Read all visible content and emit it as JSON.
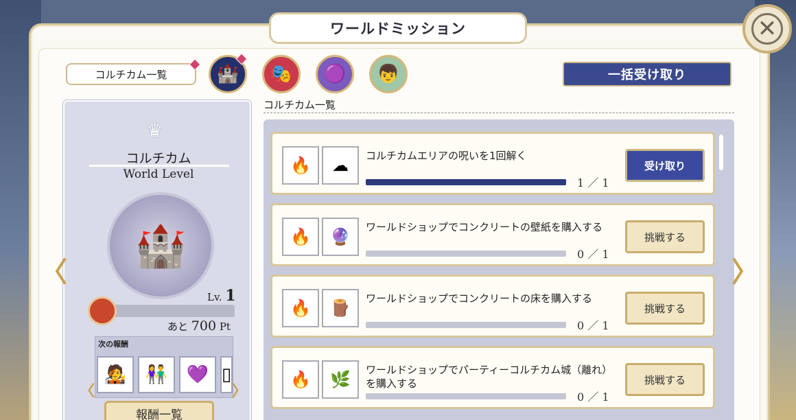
{
  "window": {
    "title": "ワールドミッション",
    "close_icon": "close-icon"
  },
  "header": {
    "category_select": "コルチカム一覧",
    "bulk_claim_label": "一括受け取り",
    "character_avatars": [
      {
        "name": "castle-emblem-avatar",
        "glyph": "🏰",
        "bg": "#23306a",
        "selected": true,
        "badge": true
      },
      {
        "name": "character-avatar-1",
        "glyph": "🎭",
        "bg": "#c93a4a",
        "selected": false,
        "badge": false
      },
      {
        "name": "character-avatar-2",
        "glyph": "🟣",
        "bg": "#7b5bbd",
        "selected": false,
        "badge": false
      },
      {
        "name": "character-avatar-3",
        "glyph": "👦",
        "bg": "#9fc7a8",
        "selected": false,
        "badge": false
      }
    ]
  },
  "list_label": "コルチカム一覧",
  "world": {
    "name": "コルチカム",
    "subtitle": "World Level",
    "level_prefix": "Lv.",
    "level": "1",
    "remaining_prefix": "あと",
    "remaining_value": "700",
    "remaining_unit": "Pt",
    "progress": 0.0,
    "rewards_title": "次の報酬",
    "reward_thumbs": [
      "🧑‍🎤",
      "👫",
      "💜",
      "▯"
    ],
    "listing_label": "報酬一覧"
  },
  "missions": [
    {
      "title": "コルチカムエリアの呪いを1回解く",
      "current": 1,
      "total": 1,
      "count_text": "1 ／ 1",
      "button": "受け取り",
      "state": "claim",
      "icons": [
        "🔥",
        "☁"
      ]
    },
    {
      "title": "ワールドショップでコンクリートの壁紙を購入する",
      "current": 0,
      "total": 1,
      "count_text": "0 ／ 1",
      "button": "挑戦する",
      "state": "challenge",
      "icons": [
        "🔥",
        "🔮"
      ]
    },
    {
      "title": "ワールドショップでコンクリートの床を購入する",
      "current": 0,
      "total": 1,
      "count_text": "0 ／ 1",
      "button": "挑戦する",
      "state": "challenge",
      "icons": [
        "🔥",
        "🪵"
      ]
    },
    {
      "title": "ワールドショップでパーティーコルチカム城（離れ）を購入する",
      "current": 0,
      "total": 1,
      "count_text": "0 ／ 1",
      "button": "挑戦する",
      "state": "challenge",
      "icons": [
        "🔥",
        "🌿"
      ]
    }
  ],
  "nav": {
    "prev_icon": "chevron-left-icon",
    "next_icon": "chevron-right-icon",
    "prev_glyph": "〈",
    "next_glyph": "〉"
  }
}
